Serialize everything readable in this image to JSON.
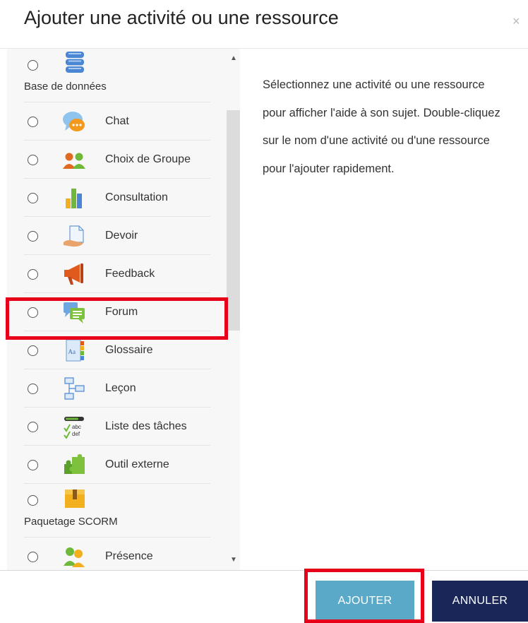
{
  "dialog": {
    "title": "Ajouter une activité ou une ressource",
    "close_label": "×"
  },
  "options": [
    {
      "label": "Base de données",
      "icon": "database-icon"
    },
    {
      "label": "Chat",
      "icon": "chat-icon"
    },
    {
      "label": "Choix de Groupe",
      "icon": "group-choice-icon"
    },
    {
      "label": "Consultation",
      "icon": "survey-chart-icon"
    },
    {
      "label": "Devoir",
      "icon": "assignment-icon"
    },
    {
      "label": "Feedback",
      "icon": "megaphone-icon"
    },
    {
      "label": "Forum",
      "icon": "forum-icon"
    },
    {
      "label": "Glossaire",
      "icon": "glossary-icon"
    },
    {
      "label": "Leçon",
      "icon": "lesson-icon"
    },
    {
      "label": "Liste des tâches",
      "icon": "checklist-icon"
    },
    {
      "label": "Outil externe",
      "icon": "puzzle-icon"
    },
    {
      "label": "Paquetage SCORM",
      "icon": "package-icon"
    },
    {
      "label": "Présence",
      "icon": "attendance-icon"
    }
  ],
  "help": {
    "text": "Sélectionnez une activité ou une ressource pour afficher l'aide à son sujet. Double-cliquez sur le nom d'une activité ou d'une ressource pour l'ajouter rapidement."
  },
  "buttons": {
    "add_label": "AJOUTER",
    "cancel_label": "ANNULER"
  },
  "colors": {
    "add_button": "#5aa9c8",
    "cancel_button": "#1a2658",
    "highlight": "#e8001b"
  }
}
